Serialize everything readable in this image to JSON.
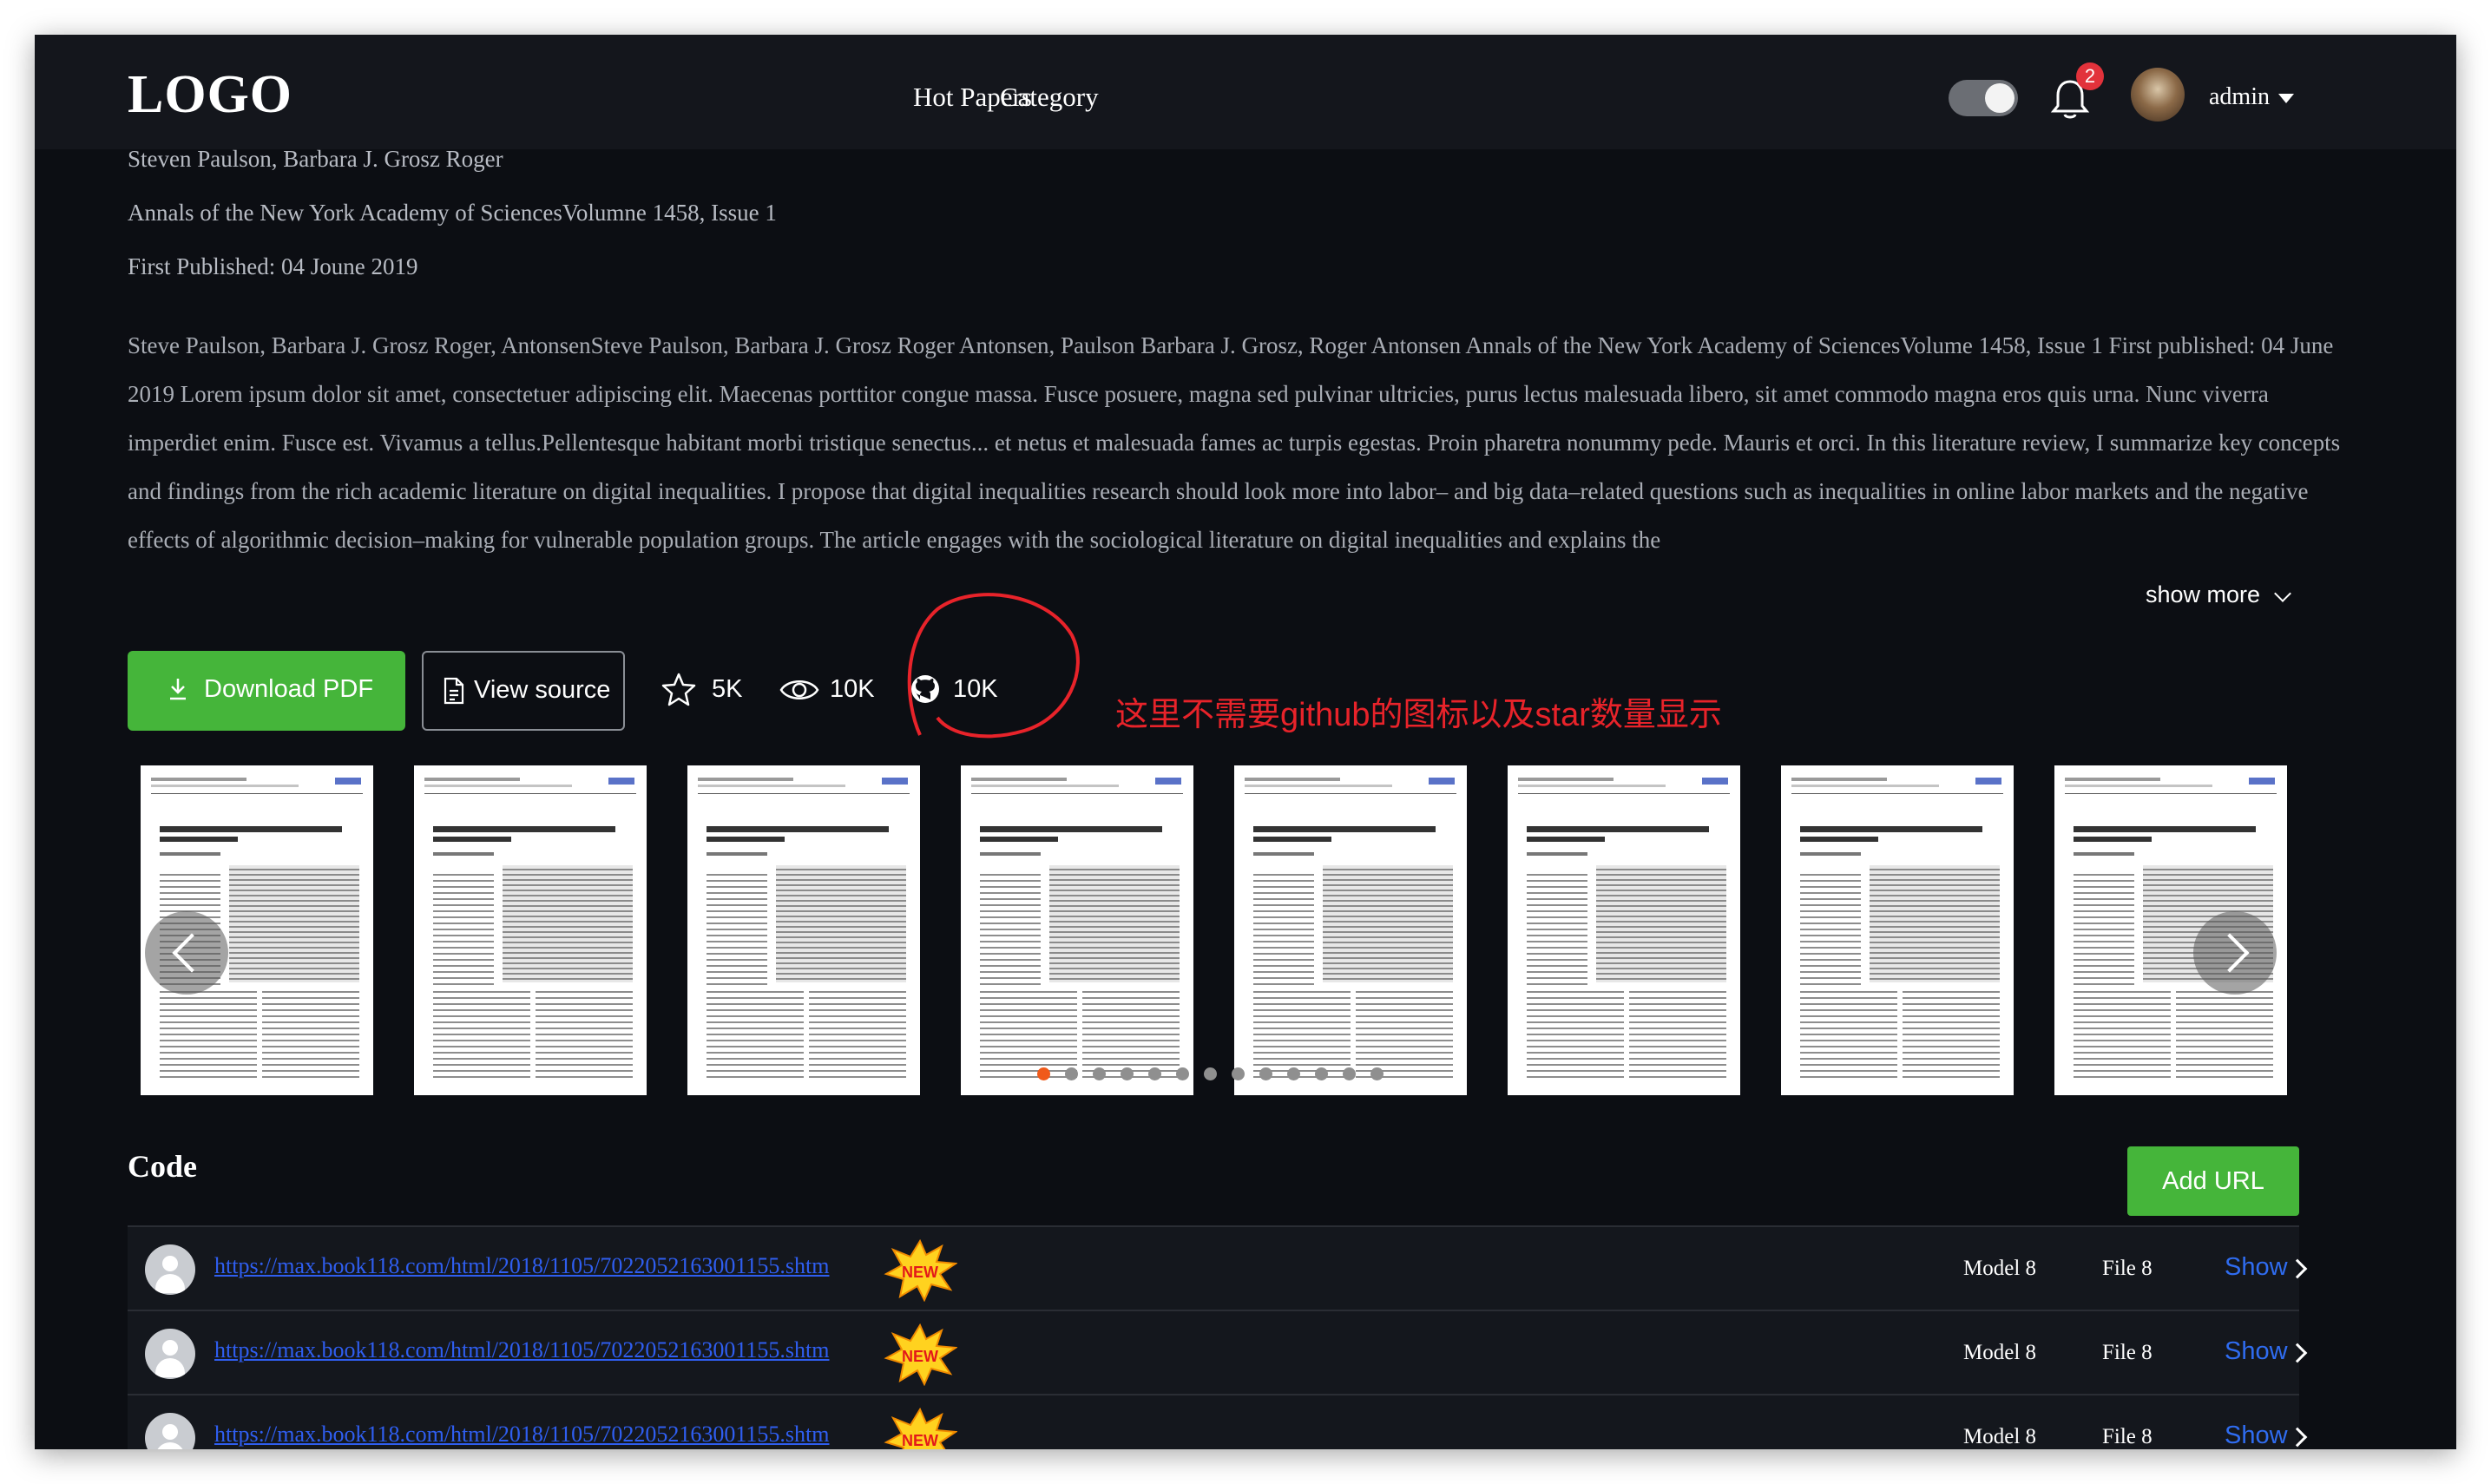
{
  "header": {
    "logo": "LOGO",
    "nav": [
      "Hot Papers",
      "Category"
    ],
    "notification_count": "2",
    "username": "admin"
  },
  "paper": {
    "authors": "Steven Paulson, Barbara J. Grosz Roger",
    "journal": "Annals of the New York Academy of SciencesVolumne 1458, Issue 1",
    "published": "First Published: 04 Joune 2019",
    "abstract": "Steve Paulson, Barbara J. Grosz Roger, AntonsenSteve Paulson, Barbara J. Grosz Roger Antonsen, Paulson Barbara J. Grosz, Roger Antonsen Annals of the New York Academy of SciencesVolume 1458, Issue 1 First published: 04 June 2019 Lorem ipsum dolor sit amet, consectetuer adipiscing elit. Maecenas porttitor congue massa. Fusce posuere, magna sed pulvinar ultricies, purus lectus malesuada libero, sit amet commodo magna eros quis urna. Nunc viverra imperdiet enim. Fusce est. Vivamus a tellus.Pellentesque habitant morbi tristique senectus... et netus et malesuada fames ac turpis egestas. Proin pharetra nonummy pede. Mauris et orci. In this literature review, I summarize key concepts and findings from the rich academic literature on digital inequalities. I propose that digital inequalities research should look more into labor– and big data–related questions such as inequalities in online labor markets and the negative effects of algorithmic decision–making for vulnerable population groups. The article engages with the sociological literature on digital inequalities and explains the",
    "show_more": "show more"
  },
  "actions": {
    "download_label": "Download PDF",
    "source_label": "View source",
    "stars": "5K",
    "views": "10K",
    "github": "10K"
  },
  "annotation": "这里不需要github的图标以及star数量显示",
  "carousel": {
    "page_count": 8,
    "dot_count": 13,
    "active_dot": 0
  },
  "code": {
    "title": "Code",
    "add_label": "Add URL",
    "new_badge": "NEW",
    "rows": [
      {
        "url": "https://max.book118.com/html/2018/1105/7022052163001155.shtm",
        "model": "Model 8",
        "file": "File 8",
        "action": "Show"
      },
      {
        "url": "https://max.book118.com/html/2018/1105/7022052163001155.shtm",
        "model": "Model 8",
        "file": "File 8",
        "action": "Show"
      },
      {
        "url": "https://max.book118.com/html/2018/1105/7022052163001155.shtm",
        "model": "Model 8",
        "file": "File 8",
        "action": "Show"
      }
    ]
  },
  "colors": {
    "background": "#0c0e13",
    "primary_green": "#45b53a",
    "link_blue": "#2f5ef0",
    "annotation_red": "#e8232a",
    "active_dot": "#f05a1a"
  }
}
